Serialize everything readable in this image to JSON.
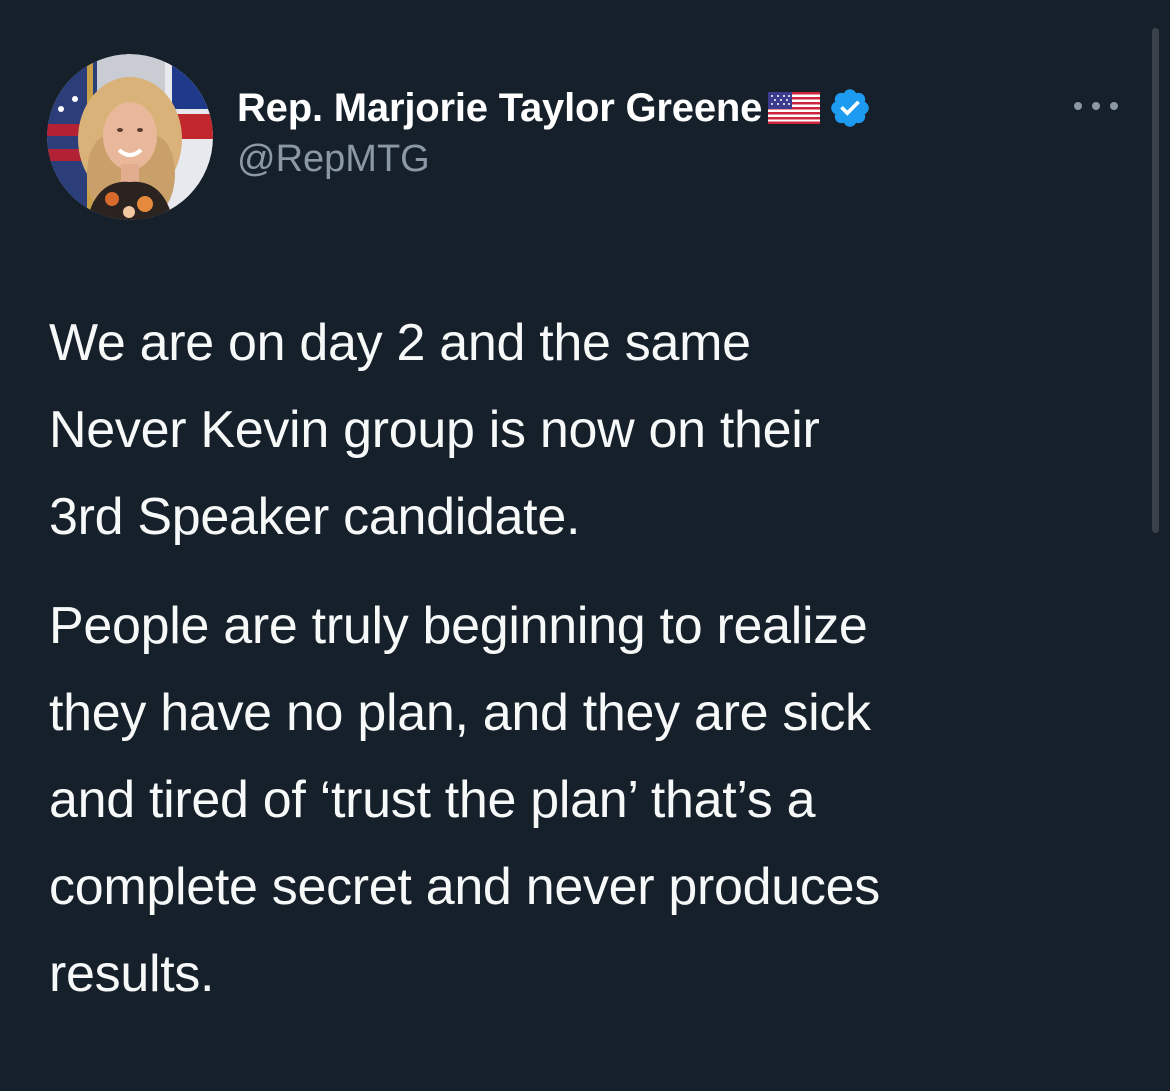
{
  "author": {
    "display_name": "Rep. Marjorie Taylor Greene",
    "flag_emoji": "us-flag",
    "verified_icon": "verified-badge-icon",
    "handle": "@RepMTG"
  },
  "more_icon": "more-options-icon",
  "tweet": {
    "paragraph1_lines": [
      "We are on day 2 and the same",
      "Never Kevin group is now on their",
      "3rd Speaker candidate."
    ],
    "paragraph2_lines": [
      "People are truly beginning to realize",
      "they have no plan, and they are sick",
      "and tired of ‘trust the plan’ that’s a",
      "complete secret and never produces",
      "results."
    ]
  },
  "colors": {
    "background": "#15202b",
    "text": "#f7f9f9",
    "secondary_text": "#8b98a5",
    "verified_blue": "#1d9bf0"
  }
}
